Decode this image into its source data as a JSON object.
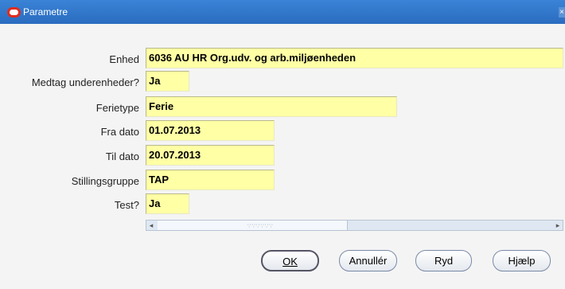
{
  "window": {
    "title": "Parametre"
  },
  "fields": [
    {
      "label": "Enhed",
      "value": "6036 AU HR Org.udv. og arb.miljøenheden"
    },
    {
      "label": "Medtag underenheder?",
      "value": "Ja"
    },
    {
      "label": "Ferietype",
      "value": "Ferie"
    },
    {
      "label": "Fra dato",
      "value": "01.07.2013"
    },
    {
      "label": "Til dato",
      "value": "20.07.2013"
    },
    {
      "label": "Stillingsgruppe",
      "value": "TAP"
    },
    {
      "label": "Test?",
      "value": "Ja"
    }
  ],
  "buttons": {
    "ok": "OK",
    "cancel": "Annullér",
    "clear": "Ryd",
    "help": "Hjælp"
  },
  "colors": {
    "title_bar": "#2a6cc0",
    "field_bg": "#ffffa5"
  },
  "icons": {
    "app": "oracle-icon",
    "close": "close-icon",
    "left": "left-arrow-icon",
    "right": "right-arrow-icon"
  }
}
